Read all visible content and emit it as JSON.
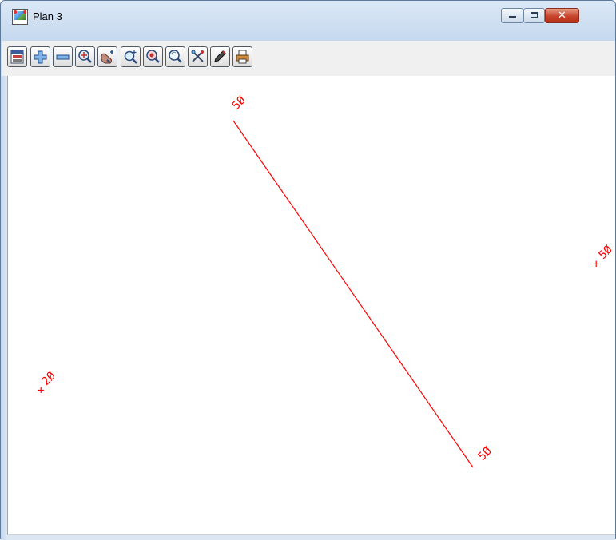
{
  "window": {
    "title": "Plan 3"
  },
  "toolbar": {
    "buttons": [
      {
        "name": "plot-setup-icon"
      },
      {
        "name": "zoom-in-plus-icon"
      },
      {
        "name": "zoom-out-minus-icon"
      },
      {
        "name": "zoom-fit-icon"
      },
      {
        "name": "pan-hand-icon"
      },
      {
        "name": "zoom-window-icon"
      },
      {
        "name": "zoom-center-icon"
      },
      {
        "name": "magnify-icon"
      },
      {
        "name": "tools-icon"
      },
      {
        "name": "pen-icon"
      },
      {
        "name": "print-icon"
      }
    ]
  },
  "plan": {
    "line_color": "#ff0000",
    "labels": {
      "top": "5Ø",
      "bottom": "5Ø",
      "right": "5Ø",
      "left": "2Ø"
    },
    "markers": {
      "right": "+",
      "left": "+"
    }
  }
}
